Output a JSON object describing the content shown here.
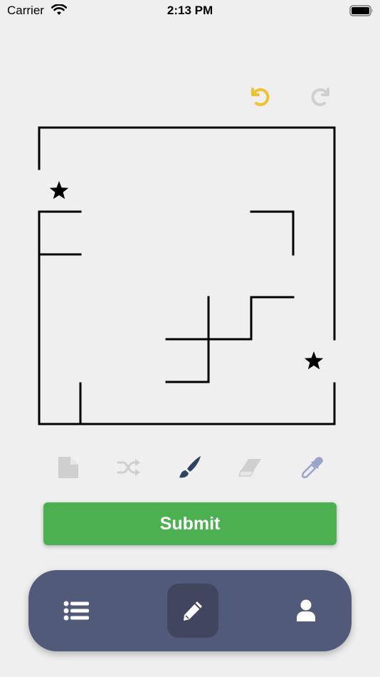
{
  "status_bar": {
    "carrier": "Carrier",
    "time": "2:13 PM"
  },
  "toolbar": {
    "undo_icon": "undo-icon",
    "redo_icon": "redo-icon",
    "undo_color": "#f2c12e",
    "redo_color": "#cfcfcf"
  },
  "tools": [
    {
      "name": "new-document-icon",
      "color": "#cfcfcf"
    },
    {
      "name": "shuffle-icon",
      "color": "#cfcfcf"
    },
    {
      "name": "paint-brush-icon",
      "color": "#2e4360"
    },
    {
      "name": "eraser-icon",
      "color": "#cfcfcf"
    },
    {
      "name": "eyedropper-icon",
      "color": "#9aa3c8"
    }
  ],
  "submit": {
    "label": "Submit",
    "color": "#4caf50"
  },
  "bottom_nav": {
    "items": [
      "list-icon",
      "pencil-icon",
      "user-icon"
    ],
    "background": "#525a7a",
    "active_background": "#41465e"
  }
}
